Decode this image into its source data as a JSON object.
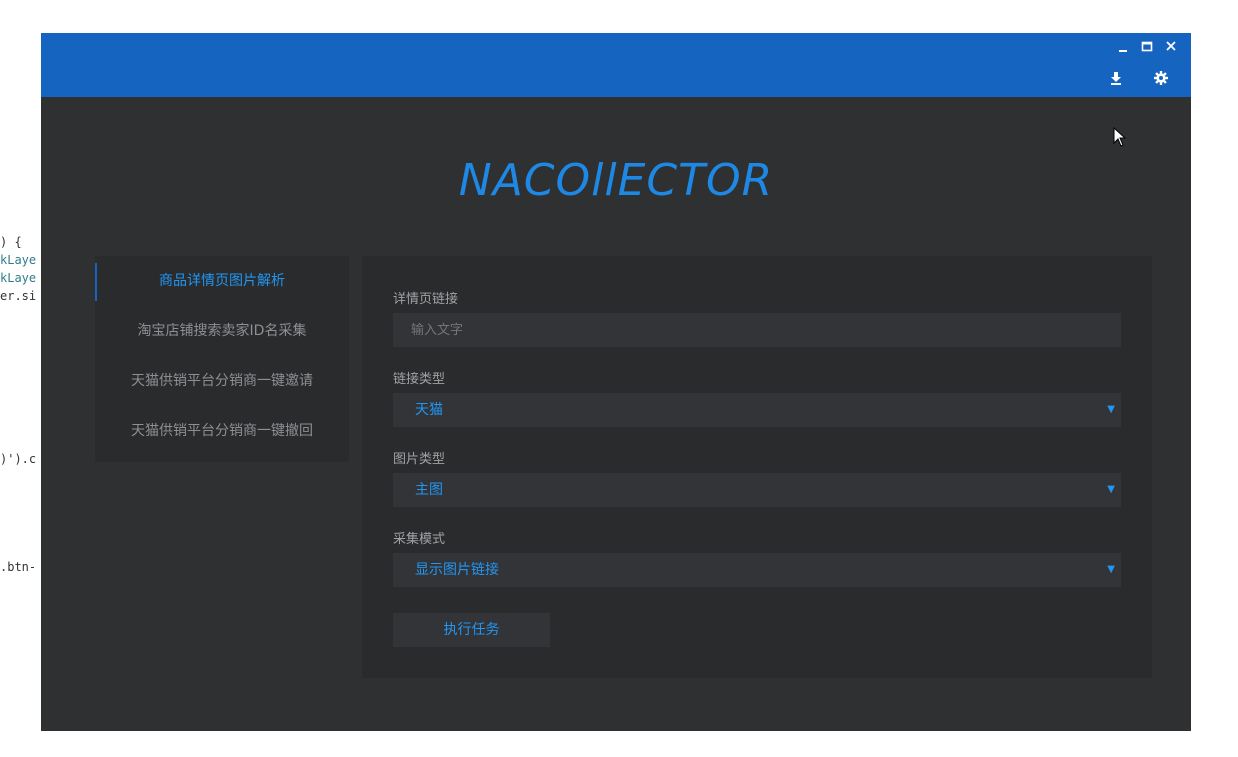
{
  "background_code": {
    "lines": [
      ") {",
      "kLaye",
      "kLaye",
      "er.si",
      ")').c",
      ".btn-"
    ]
  },
  "window": {
    "controls": {
      "minimize_icon": "minimize-icon",
      "maximize_icon": "maximize-icon",
      "close_icon": "close-icon"
    },
    "toolbar": {
      "download_icon": "download-icon",
      "settings_icon": "gear-icon"
    },
    "logo_text": "NACOllECTOR",
    "accent_color": "#1565c0"
  },
  "nav": {
    "items": [
      {
        "label": "商品详情页图片解析",
        "active": true
      },
      {
        "label": "淘宝店铺搜索卖家ID名采集",
        "active": false
      },
      {
        "label": "天猫供销平台分销商一键邀请",
        "active": false
      },
      {
        "label": "天猫供销平台分销商一键撤回",
        "active": false
      }
    ]
  },
  "form": {
    "link": {
      "label": "详情页链接",
      "placeholder": "输入文字"
    },
    "link_type": {
      "label": "链接类型",
      "value": "天猫"
    },
    "image_type": {
      "label": "图片类型",
      "value": "主图"
    },
    "collect_mode": {
      "label": "采集模式",
      "value": "显示图片链接"
    },
    "submit_label": "执行任务"
  }
}
